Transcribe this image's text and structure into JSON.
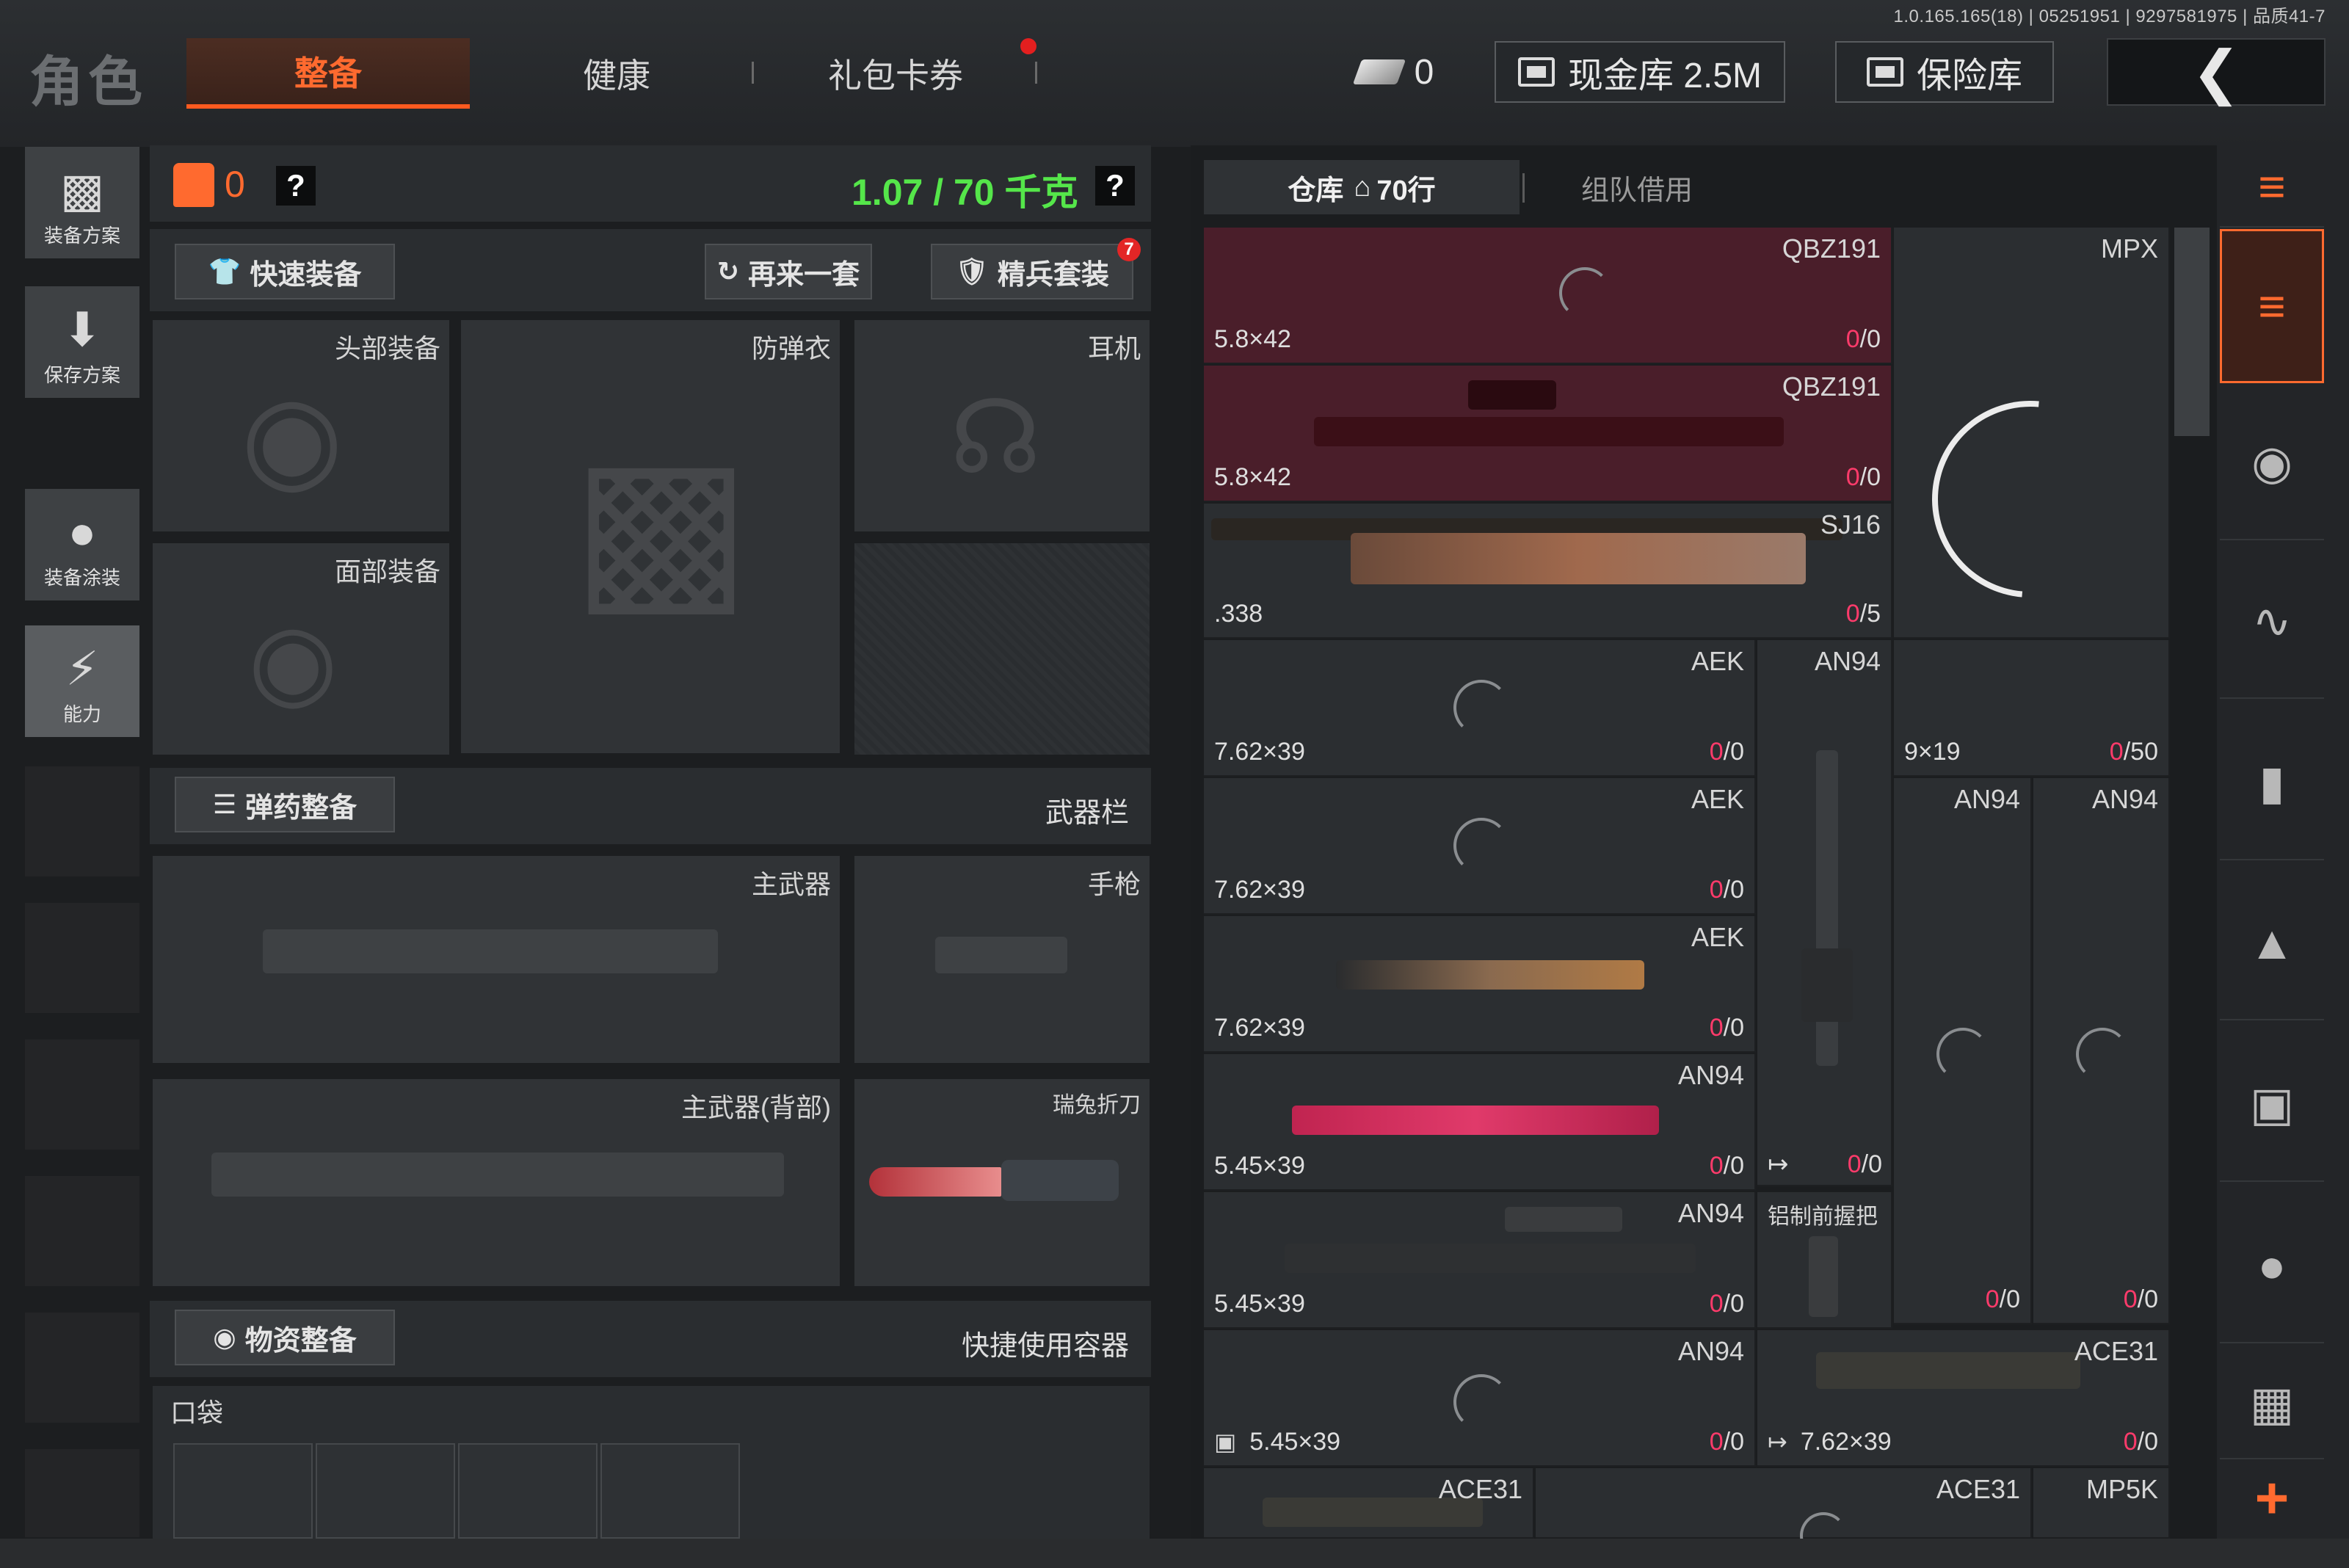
{
  "version": "1.0.165.165(18) | 05251951 | 9297581975 | 品质41-7",
  "header": {
    "title": "角色",
    "tabs": [
      {
        "label": "整备",
        "active": true
      },
      {
        "label": "健康",
        "active": false
      },
      {
        "label": "礼包卡券",
        "active": false,
        "has_dot": true
      }
    ],
    "coin_count": "0",
    "cash_vault_label": "现金库 2.5M",
    "safe_label": "保险库",
    "back_icon": "chevron-left-icon"
  },
  "left_rail": [
    {
      "label": "装备方案",
      "icon": "vest-icon"
    },
    {
      "label": "保存方案",
      "icon": "download-icon"
    },
    {
      "label": "装备涂装",
      "icon": "helmet-paint-icon"
    },
    {
      "label": "能力",
      "icon": "ability-icon"
    }
  ],
  "equip": {
    "bag_count": "0",
    "help": "?",
    "weight": "1.07 / 70 千克",
    "quick_equip": "快速装备",
    "redo_one": "再来一套",
    "elite_set": "精兵套装",
    "elite_badge": "7",
    "slots": {
      "head": "头部装备",
      "armor": "防弹衣",
      "earphone": "耳机",
      "face": "面部装备",
      "primary": "主武器",
      "pistol": "手枪",
      "primary_back": "主武器(背部)",
      "knife": "瑞兔折刀"
    },
    "ammo_section": "弹药整备",
    "weapon_bar": "武器栏",
    "supply_section": "物资整备",
    "quick_container": "快捷使用容器",
    "pocket": "口袋"
  },
  "warehouse": {
    "tab_active": "仓库",
    "tab_active_rows": "70行",
    "tab_other": "组队借用",
    "cells": {
      "c1": {
        "name": "QBZ191",
        "caliber": "5.8×42",
        "count": "0",
        "max": "0"
      },
      "c2": {
        "name": "QBZ191",
        "caliber": "5.8×42",
        "count": "0",
        "max": "0"
      },
      "mpx": {
        "name": "MPX",
        "caliber": "9×19",
        "count": "0",
        "max": "50"
      },
      "c3": {
        "name": "SJ16",
        "caliber": ".338",
        "count": "0",
        "max": "5"
      },
      "c4": {
        "name": "AEK",
        "caliber": "7.62×39",
        "count": "0",
        "max": "0"
      },
      "an94a": {
        "name": "AN94"
      },
      "c5": {
        "name": "AEK",
        "caliber": "7.62×39",
        "count": "0",
        "max": "0"
      },
      "an94b": {
        "name": "AN94",
        "count": "0",
        "max": "0"
      },
      "an94c": {
        "name": "AN94",
        "count": "0",
        "max": "0"
      },
      "c6": {
        "name": "AEK",
        "caliber": "7.62×39",
        "count": "0",
        "max": "0"
      },
      "c7": {
        "name": "AN94",
        "caliber": "5.45×39",
        "count": "0",
        "max": "0"
      },
      "an94a_count": {
        "count": "0",
        "max": "0"
      },
      "c8": {
        "name": "AN94",
        "caliber": "5.45×39",
        "count": "0",
        "max": "0"
      },
      "grip": {
        "name": "铝制前握把"
      },
      "c9": {
        "name": "AN94",
        "caliber": "5.45×39",
        "count": "0",
        "max": "0"
      },
      "ace31": {
        "name": "ACE31",
        "caliber": "7.62×39",
        "count": "0",
        "max": "0"
      },
      "r1": {
        "name": "ACE31"
      },
      "r2": {
        "name": "ACE31"
      },
      "r3": {
        "name": "MP5K"
      }
    }
  },
  "right_rail": [
    {
      "icon": "layers-refresh-icon"
    },
    {
      "icon": "layers-download-icon",
      "active": true
    },
    {
      "icon": "helmet-icon"
    },
    {
      "icon": "rifle-icon"
    },
    {
      "icon": "magazine-icon"
    },
    {
      "icon": "bullet-icon"
    },
    {
      "icon": "scope-icon"
    },
    {
      "icon": "grenade-icon"
    },
    {
      "icon": "box-icon"
    },
    {
      "icon": "plus-icon"
    }
  ],
  "colors": {
    "accent": "#ff6a2f",
    "weight_green": "#55e64a",
    "count_red": "#ff3b6b",
    "rare_red_bg": "#4a1e2a"
  }
}
